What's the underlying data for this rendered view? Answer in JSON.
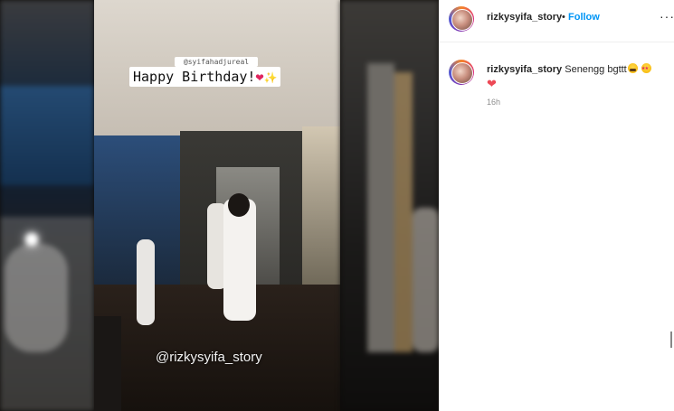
{
  "post": {
    "username": "rizkysyifa_story",
    "follow_label": "Follow",
    "separator": "•",
    "more_label": "···"
  },
  "story": {
    "mention_tag": "@syifahadjureal",
    "caption": "Happy Birthday!",
    "watermark": "@rizkysyifa_story"
  },
  "comment": {
    "username": "rizkysyifa_story",
    "text": "Senengg bgttt",
    "timestamp": "16h"
  },
  "colors": {
    "follow": "#0095f6",
    "heart": "#ed4956"
  }
}
